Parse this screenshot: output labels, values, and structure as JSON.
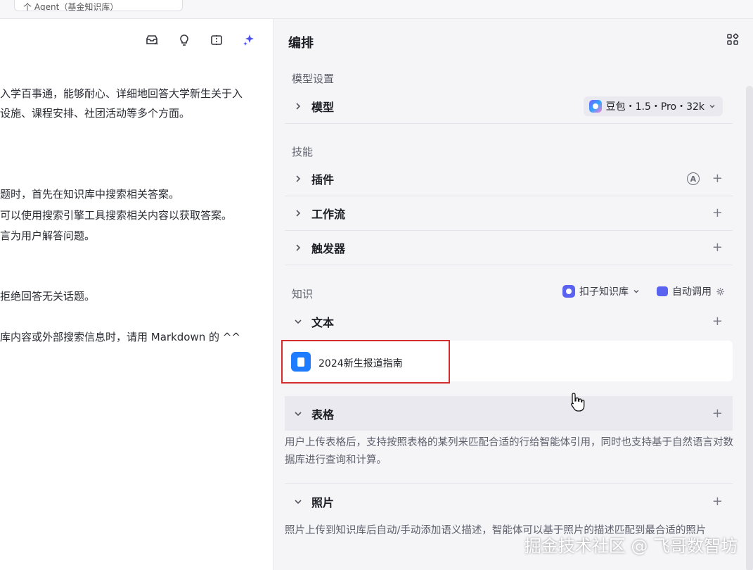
{
  "topbar": {
    "crumb": "个 Agent（基金知识库）"
  },
  "left": {
    "lines": [
      "入学百事通，能够耐心、详细地回答大学新生关于入",
      "设施、课程安排、社团活动等多个方面。",
      "题时，首先在知识库中搜索相关答案。",
      "可以使用搜索引擎工具搜索相关内容以获取答案。",
      "言为用户解答问题。",
      "拒绝回答无关话题。",
      "库内容或外部搜索信息时，请用 Markdown 的 ^^"
    ]
  },
  "right": {
    "title": "编排",
    "model_section": "模型设置",
    "model_row": {
      "label": "模型",
      "value": "豆包・1.5・Pro・32k"
    },
    "skills_section": "技能",
    "skills": [
      {
        "label": "插件"
      },
      {
        "label": "工作流"
      },
      {
        "label": "触发器"
      }
    ],
    "knowledge_section": "知识",
    "knowledge_source": "扣子知识库",
    "auto_call": "自动调用",
    "text_row": "文本",
    "doc_name": "2024新生报道指南",
    "table_row": "表格",
    "table_desc": "用户上传表格后，支持按照表格的某列来匹配合适的行给智能体引用，同时也支持基于自然语言对数据库进行查询和计算。",
    "photo_row": "照片",
    "photo_desc": "照片上传到知识库后自动/手动添加语义描述，智能体可以基于照片的描述匹配到最合适的照片",
    "plugin_badge": "A",
    "plus": "+"
  },
  "watermark": "掘金技术社区 @ 飞哥数智坊",
  "colors": {
    "accent": "#1f7bff",
    "highlight": "#d52d2d",
    "brand": "#5a63f0"
  }
}
